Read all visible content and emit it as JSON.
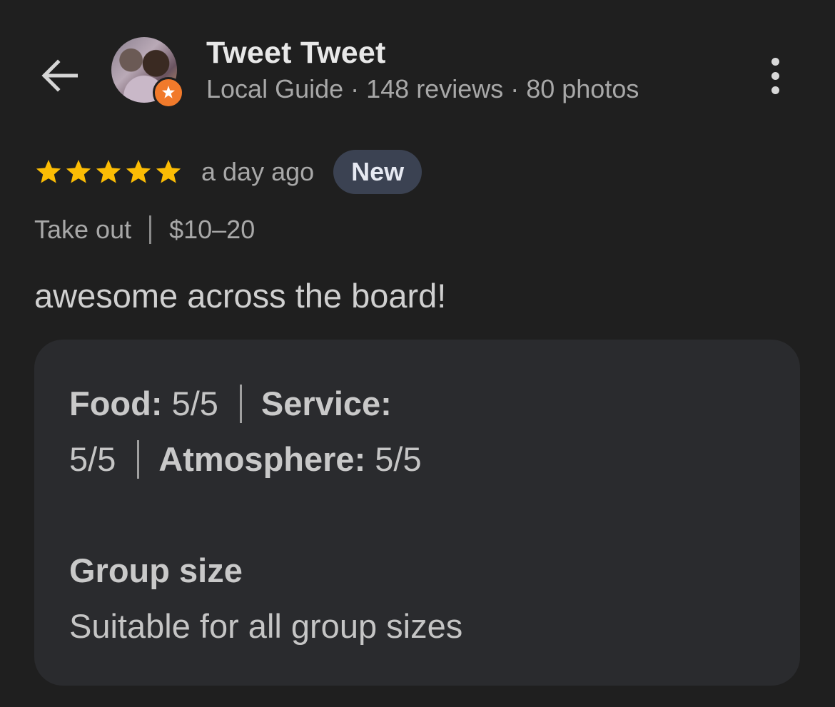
{
  "header": {
    "back_icon": "arrow-back-icon",
    "avatar_icon": "user-avatar",
    "badge_icon": "local-guide-star-icon",
    "name": "Tweet Tweet",
    "meta": "Local Guide · 148 reviews · 80 photos",
    "more_icon": "more-vertical-icon"
  },
  "review": {
    "stars": 5,
    "star_color": "#fbbc04",
    "time_ago": "a day ago",
    "badge": "New",
    "service_type": "Take out",
    "price_range": "$10–20",
    "text": "awesome across the board!"
  },
  "ratings_card": {
    "food_label": "Food:",
    "food_value": "5/5",
    "service_label": "Service:",
    "service_value": "5/5",
    "atmosphere_label": "Atmosphere:",
    "atmosphere_value": "5/5",
    "group_title": "Group size",
    "group_value": "Suitable for all group sizes"
  }
}
